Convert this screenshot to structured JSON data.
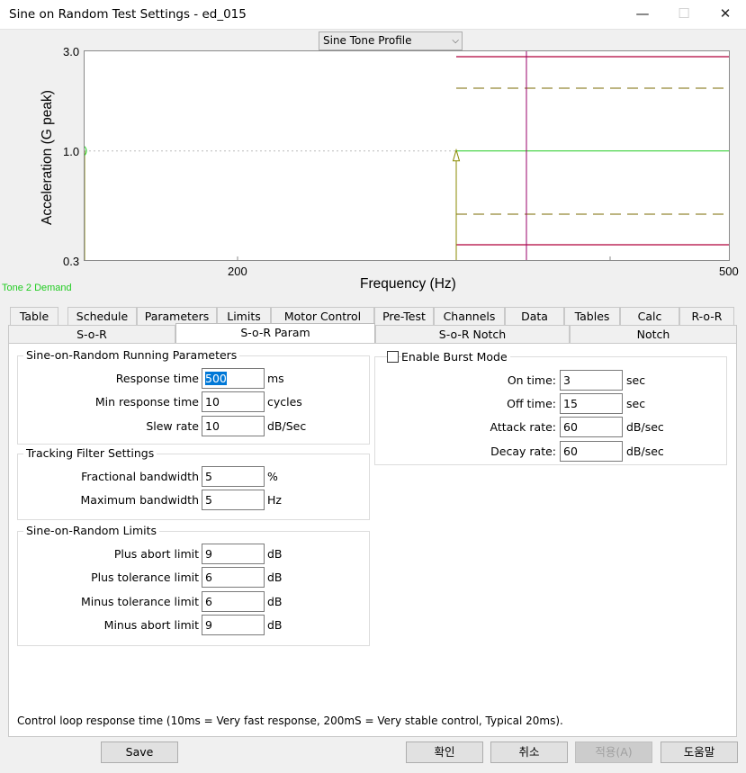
{
  "window": {
    "title": "Sine on Random Test Settings - ed_015",
    "minimize": "—",
    "maximize": "☐",
    "close": "✕"
  },
  "profile_select": {
    "value": "Sine Tone Profile",
    "arrow": "⌵"
  },
  "chart_data": {
    "type": "line",
    "xlabel": "Frequency (Hz)",
    "ylabel": "Acceleration (G peak)",
    "x_ticks": [
      "200",
      "500"
    ],
    "y_ticks": [
      "3.0",
      "1.0",
      "0.3"
    ],
    "y_scale": "log",
    "ylim": [
      0.3,
      3.0
    ],
    "x_scale": "log",
    "series": [
      {
        "name": "Tone 2 Demand",
        "color": "#22cc22",
        "x_start": 200,
        "y": 1.0
      }
    ]
  },
  "legend_label": "Tone 2 Demand",
  "tabs_row1": [
    "Table",
    "Schedule",
    "Parameters",
    "Limits",
    "Motor Control",
    "Pre-Test",
    "Channels",
    "Data",
    "Tables",
    "Calc",
    "R-o-R"
  ],
  "tabs_row2": [
    "S-o-R",
    "S-o-R Param",
    "S-o-R Notch",
    "Notch"
  ],
  "running": {
    "legend": "Sine-on-Random Running Parameters",
    "rows": [
      {
        "label": "Response time",
        "value": "500",
        "unit": "ms"
      },
      {
        "label": "Min response time",
        "value": "10",
        "unit": "cycles"
      },
      {
        "label": "Slew rate",
        "value": "10",
        "unit": "dB/Sec"
      }
    ]
  },
  "tracking": {
    "legend": "Tracking Filter Settings",
    "rows": [
      {
        "label": "Fractional bandwidth",
        "value": "5",
        "unit": "%"
      },
      {
        "label": "Maximum bandwidth",
        "value": "5",
        "unit": "Hz"
      }
    ]
  },
  "limits": {
    "legend": "Sine-on-Random Limits",
    "rows": [
      {
        "label": "Plus abort limit",
        "value": "9",
        "unit": "dB"
      },
      {
        "label": "Plus tolerance limit",
        "value": "6",
        "unit": "dB"
      },
      {
        "label": "Minus tolerance limit",
        "value": "6",
        "unit": "dB"
      },
      {
        "label": "Minus abort limit",
        "value": "9",
        "unit": "dB"
      }
    ]
  },
  "burst": {
    "legend": "Enable Burst Mode",
    "checked": false,
    "rows": [
      {
        "label": "On time:",
        "value": "3",
        "unit": "sec"
      },
      {
        "label": "Off time:",
        "value": "15",
        "unit": "sec"
      },
      {
        "label": "Attack rate:",
        "value": "60",
        "unit": "dB/sec"
      },
      {
        "label": "Decay rate:",
        "value": "60",
        "unit": "dB/sec"
      }
    ]
  },
  "hint": "Control loop response time (10ms = Very fast response, 200mS = Very stable control, Typical 20ms).",
  "buttons": {
    "save": "Save",
    "ok": "확인",
    "cancel": "취소",
    "apply": "적용(A)",
    "help": "도움말"
  },
  "colors": {
    "demand": "#22cc22",
    "abort": "#b0003a",
    "tolerance": "#7a6a00",
    "marker": "#8a8a00",
    "vline": "#9a006a"
  }
}
